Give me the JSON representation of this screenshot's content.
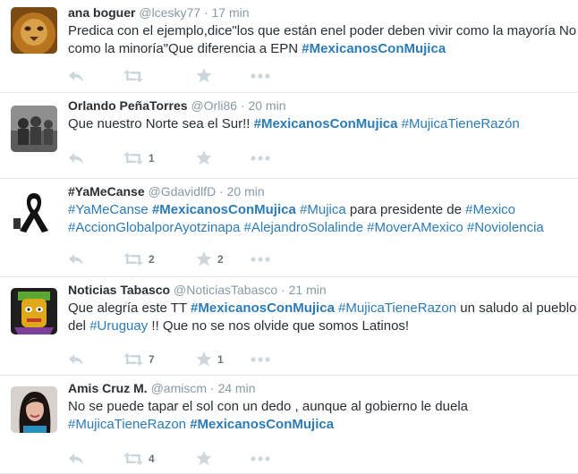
{
  "colors": {
    "link": "#2b7bb9",
    "meta": "#8899a6",
    "icon": "#ccd6dd",
    "divider": "#e1e8ed"
  },
  "icons": [
    "reply-icon",
    "retweet-icon",
    "favorite-icon",
    "more-icon"
  ],
  "tweets": [
    {
      "fullname": "ana boguer",
      "handle": "@lcesky77",
      "dot": "·",
      "time": "17 min",
      "avatar": "lion-photo",
      "lines": [
        [
          {
            "t": "Predica con el ejemplo,dice\"los que están enel poder deben vivir como la mayoría No"
          }
        ],
        [
          {
            "t": "como la minoría\"Que diferencia a EPN "
          },
          {
            "t": "#MexicanosConMujica",
            "tag": true,
            "bold": true
          }
        ]
      ],
      "retweets": "",
      "favorites": ""
    },
    {
      "fullname": "Orlando PeñaTorres",
      "handle": "@Orli86",
      "dot": "·",
      "time": "20 min",
      "avatar": "group-photo",
      "lines": [
        [
          {
            "t": "Que nuestro Norte sea el Sur!! "
          },
          {
            "t": "#MexicanosConMujica",
            "tag": true,
            "bold": true
          },
          {
            "t": " "
          },
          {
            "t": "#MujicaTieneRazón",
            "tag": true
          }
        ]
      ],
      "retweets": "1",
      "favorites": ""
    },
    {
      "fullname": "#YaMeCanse",
      "handle": "@GdavidlfD",
      "dot": "·",
      "time": "20 min",
      "avatar": "black-ribbon",
      "lines": [
        [
          {
            "t": "#YaMeCanse",
            "tag": true
          },
          {
            "t": " "
          },
          {
            "t": "#MexicanosConMujica",
            "tag": true,
            "bold": true
          },
          {
            "t": " "
          },
          {
            "t": "#Mujica",
            "tag": true
          },
          {
            "t": " para presidente de "
          },
          {
            "t": "#Mexico",
            "tag": true
          }
        ],
        [
          {
            "t": "#AccionGlobalporAyotzinapa",
            "tag": true
          },
          {
            "t": " "
          },
          {
            "t": "#AlejandroSolalinde",
            "tag": true
          },
          {
            "t": " "
          },
          {
            "t": "#MoverAMexico",
            "tag": true
          },
          {
            "t": " "
          },
          {
            "t": "#Noviolencia",
            "tag": true
          }
        ]
      ],
      "retweets": "2",
      "favorites": "2"
    },
    {
      "fullname": "Noticias Tabasco",
      "handle": "@NoticiasTabasco",
      "dot": "·",
      "time": "21 min",
      "avatar": "mask-logo",
      "lines": [
        [
          {
            "t": "Que alegría este TT "
          },
          {
            "t": "#MexicanosConMujica",
            "tag": true,
            "bold": true
          },
          {
            "t": " "
          },
          {
            "t": "#MujicaTieneRazon",
            "tag": true
          },
          {
            "t": " un saludo al pueblo"
          }
        ],
        [
          {
            "t": "del "
          },
          {
            "t": "#Uruguay",
            "tag": true
          },
          {
            "t": " !! Que no se nos olvide que somos Latinos!"
          }
        ]
      ],
      "retweets": "7",
      "favorites": "1"
    },
    {
      "fullname": "Amis Cruz M.",
      "handle": "@amiscm",
      "dot": "·",
      "time": "24 min",
      "avatar": "woman-photo",
      "lines": [
        [
          {
            "t": "No se puede tapar el sol con un dedo , aunque al gobierno le duela"
          }
        ],
        [
          {
            "t": "#MujicaTieneRazon",
            "tag": true
          },
          {
            "t": " "
          },
          {
            "t": "#MexicanosConMujica",
            "tag": true,
            "bold": true
          }
        ]
      ],
      "retweets": "4",
      "favorites": ""
    }
  ]
}
